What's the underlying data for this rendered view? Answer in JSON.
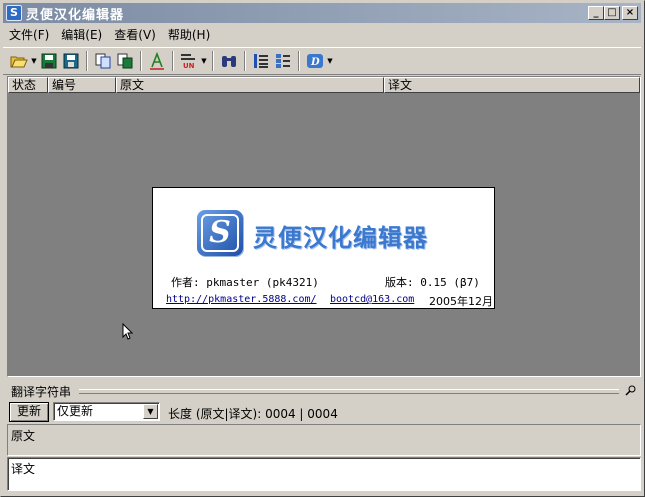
{
  "window": {
    "title": "灵便汉化编辑器",
    "app_icon_glyph": "S",
    "controls": {
      "minimize": "_",
      "maximize": "□",
      "close": "×"
    }
  },
  "menu": [
    {
      "label": "文件",
      "accel": "(F)"
    },
    {
      "label": "编辑",
      "accel": "(E)"
    },
    {
      "label": "查看",
      "accel": "(V)"
    },
    {
      "label": "帮助",
      "accel": "(H)"
    }
  ],
  "list": {
    "columns": [
      "状态",
      "编号",
      "原文",
      "译文"
    ]
  },
  "splash": {
    "logo_glyph": "S",
    "title": "灵便汉化编辑器",
    "author": "作者: pkmaster (pk4321)",
    "version": "版本: 0.15 (β7)",
    "homepage": "http://pkmaster.5888.com/",
    "email": "bootcd@163.com",
    "date": "2005年12月"
  },
  "panel": {
    "title": "翻译字符串",
    "update_button": "更新",
    "mode_select": "仅更新",
    "length_text": "长度 (原文|译文): 0004 | 0004",
    "source_label": "原文",
    "translation_value": "译文"
  },
  "colors": {
    "title_gradient_start": "#7b8ba3",
    "list_background": "#808080",
    "splash_title": "#3b78cf",
    "link": "#00008b"
  }
}
